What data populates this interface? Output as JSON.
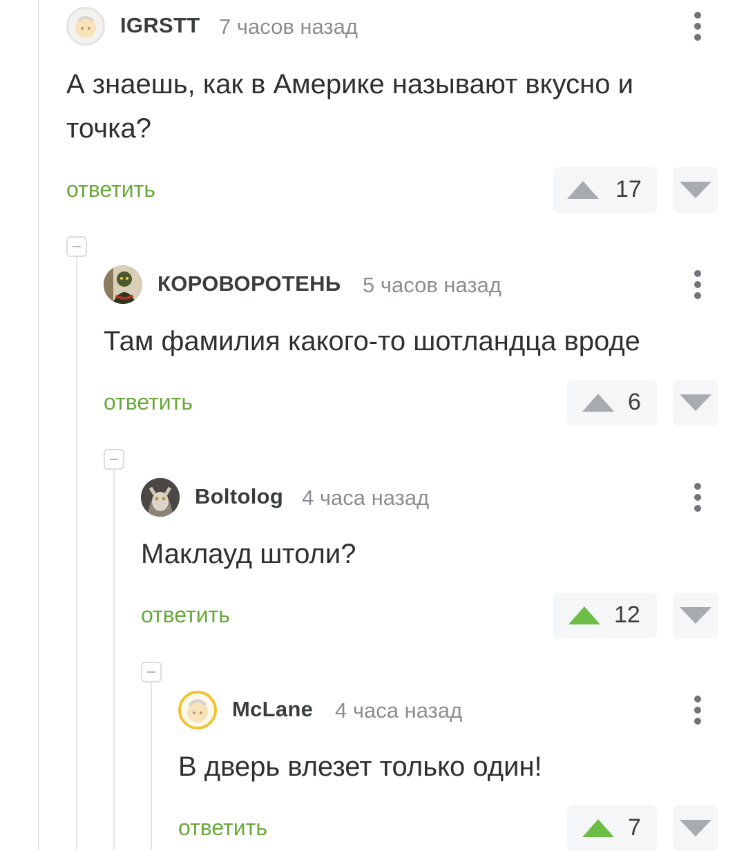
{
  "comments": [
    {
      "author": "IGRSTT",
      "time": "7 часов назад",
      "text": "А знаешь, как в Америке называют вкусно и точка?",
      "reply_label": "ответить",
      "rating": "17",
      "upvoted": false,
      "avatar": "default-pale-avatar"
    },
    {
      "author": "КОРОВОРОТЕНЬ",
      "time": "5 часов назад",
      "text": "Там фамилия какого-то шотландца вроде",
      "reply_label": "ответить",
      "rating": "6",
      "upvoted": false,
      "avatar": "goblin-photo-avatar"
    },
    {
      "author": "Boltolog",
      "time": "4 часа назад",
      "text": "Маклауд штоли?",
      "reply_label": "ответить",
      "rating": "12",
      "upvoted": true,
      "avatar": "cat-photo-avatar"
    },
    {
      "author": "McLane",
      "time": "4 часа назад",
      "text": "В дверь влезет только один!",
      "reply_label": "ответить",
      "rating": "7",
      "upvoted": true,
      "avatar": "default-yellow-avatar"
    }
  ],
  "colors": {
    "accent_green": "#68a83a",
    "upvote_active": "#6cbd45",
    "vote_inactive": "#a8abaf",
    "meta_gray": "#8a8d91"
  }
}
